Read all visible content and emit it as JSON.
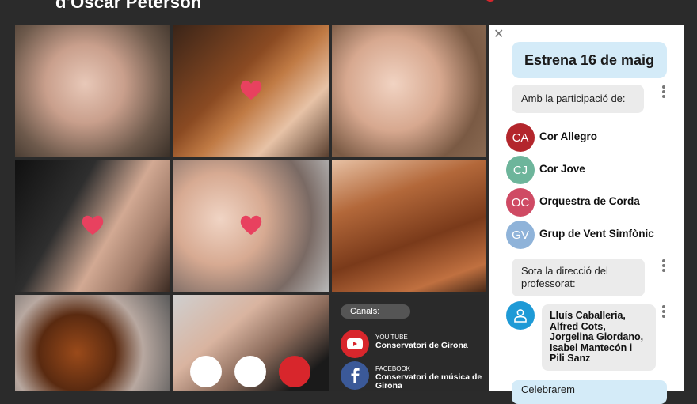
{
  "poster": {
    "title_partial": "d'Oscar Peterson"
  },
  "photos": [
    {
      "name": "child-singing-photo"
    },
    {
      "name": "violin-playing-photo"
    },
    {
      "name": "girl-singing-photo"
    },
    {
      "name": "clarinet-photo"
    },
    {
      "name": "boy-singing-photo"
    },
    {
      "name": "cello-bow-photo"
    },
    {
      "name": "violin-scroll-photo"
    },
    {
      "name": "oboe-player-photo"
    }
  ],
  "channels": {
    "label": "Canals:",
    "items": [
      {
        "kicker": "YOU TUBE",
        "name": "Conservatori de Girona",
        "icon": "youtube-icon",
        "color": "#d8262c"
      },
      {
        "kicker": "FACEBOOK",
        "name": "Conservatori de música de Girona",
        "icon": "facebook-icon",
        "color": "#3b5998"
      }
    ]
  },
  "chat": {
    "headline": "Estrena 16 de maig",
    "participation_intro": "Amb la participació de:",
    "groups": [
      {
        "initials": "CA",
        "name": "Cor Allegro",
        "color": "#b3262c"
      },
      {
        "initials": "CJ",
        "name": "Cor Jove",
        "color": "#6db59b"
      },
      {
        "initials": "OC",
        "name": "Orquestra de Corda",
        "color": "#cf4a64"
      },
      {
        "initials": "GV",
        "name": "Grup de Vent Simfònic",
        "color": "#8fb3d9"
      }
    ],
    "direction_intro": "Sota la direcció del professorat:",
    "teachers": "Lluís Caballeria, Alfred Cots, Jorgelina Giordano, Isabel Mantecón i Pili Sanz",
    "footer_partial": "Celebrarem"
  },
  "colors": {
    "background": "#2b2b2b",
    "accent_red": "#d8262c",
    "heart": "#e8415f",
    "headline_bubble": "#d4ebf8",
    "bubble": "#ebebeb"
  }
}
